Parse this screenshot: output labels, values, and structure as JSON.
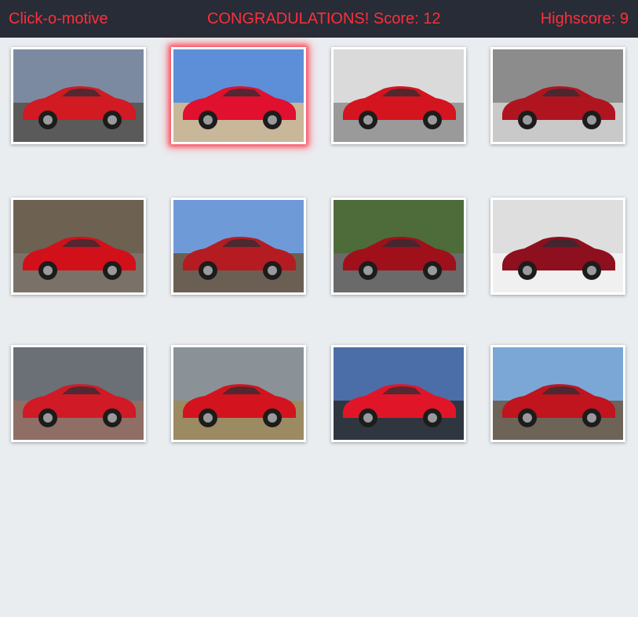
{
  "header": {
    "brand": "Click-o-motive",
    "status": "CONGRADULATIONS! Score: 12",
    "highscore": "Highscore: 9",
    "background": "#272c36",
    "text_color": "#ff2e3b"
  },
  "cards": [
    {
      "name": "red-porsche-911-card",
      "sky": "#7b8aa0",
      "ground": "#5a5a5a",
      "car": "#d11a22",
      "highlighted": false
    },
    {
      "name": "red-audi-r8-spyder-card",
      "sky": "#5d8fd8",
      "ground": "#c9b79a",
      "car": "#e0102e",
      "highlighted": true
    },
    {
      "name": "red-ferrari-458-card",
      "sky": "#dadada",
      "ground": "#9a9a9a",
      "car": "#d4141e",
      "highlighted": false
    },
    {
      "name": "red-mercedes-sl-card",
      "sky": "#8c8c8c",
      "ground": "#c9c9c9",
      "car": "#b0151f",
      "highlighted": false
    },
    {
      "name": "red-saleen-s7-card",
      "sky": "#6d6152",
      "ground": "#7a7268",
      "car": "#d2101a",
      "highlighted": false
    },
    {
      "name": "red-bentley-convertible-card",
      "sky": "#6f9ad8",
      "ground": "#6b5f53",
      "car": "#b51c22",
      "highlighted": false
    },
    {
      "name": "red-alfa-8c-card",
      "sky": "#4e6b3a",
      "ground": "#6a6a6a",
      "car": "#a0101a",
      "highlighted": false
    },
    {
      "name": "red-mclaren-650s-spider-card",
      "sky": "#dedede",
      "ground": "#f0f0f0",
      "car": "#8e0f1d",
      "highlighted": false
    },
    {
      "name": "red-pagani-huayra-card",
      "sky": "#6b6f76",
      "ground": "#8f6e66",
      "car": "#d01a26",
      "highlighted": false
    },
    {
      "name": "red-maserati-granturismo-card",
      "sky": "#8a9298",
      "ground": "#9c8a62",
      "car": "#d3141e",
      "highlighted": false
    },
    {
      "name": "red-lamborghini-gallardo-card",
      "sky": "#4c6ea8",
      "ground": "#2f3640",
      "car": "#e01628",
      "highlighted": false
    },
    {
      "name": "red-corvette-convertible-card",
      "sky": "#7ba7d6",
      "ground": "#6e6357",
      "car": "#c0141e",
      "highlighted": false
    }
  ]
}
